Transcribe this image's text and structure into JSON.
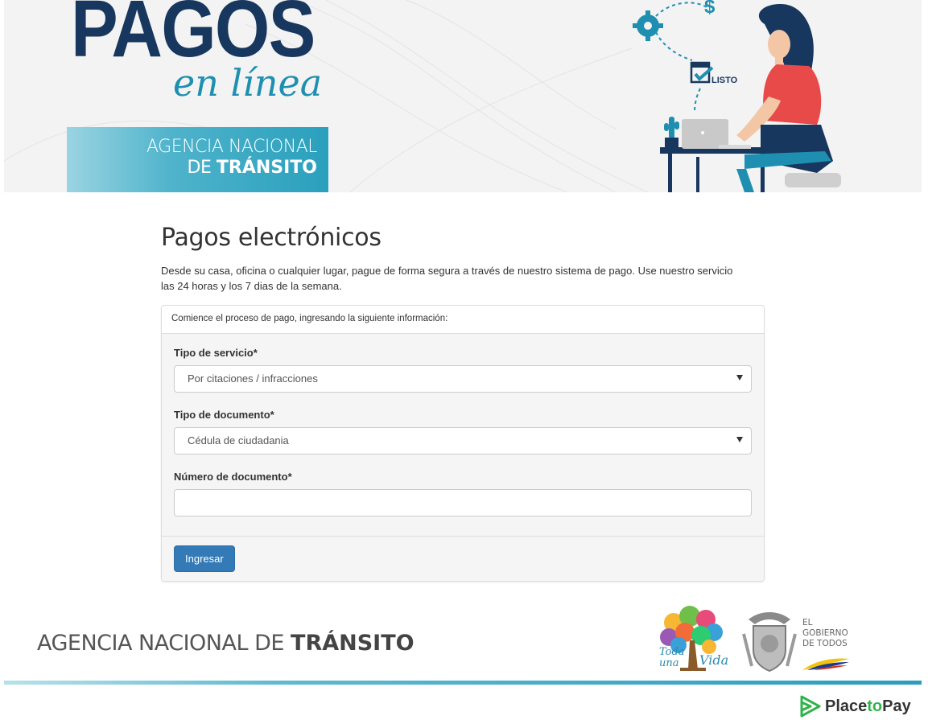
{
  "banner": {
    "title": "PAGOS",
    "subtitle": "en línea",
    "agency_line1": "AGENCIA NACIONAL",
    "agency_line2_prefix": "DE ",
    "agency_line2_bold": "TRÁNSITO",
    "listo_label": "LISTO",
    "illustration_icons": [
      "gear-icon",
      "dollar-icon",
      "calendar-check-icon",
      "laptop-icon",
      "cactus-icon",
      "woman-at-desk-illustration"
    ]
  },
  "main": {
    "title": "Pagos electrónicos",
    "intro": "Desde su casa, oficina o cualquier lugar, pague de forma segura a través de nuestro sistema de pago. Use nuestro servicio las 24 horas y los 7 dias de la semana."
  },
  "form": {
    "heading": "Comience el proceso de pago, ingresando la siguiente información:",
    "service_label": "Tipo de servicio*",
    "service_value": "Por citaciones / infracciones",
    "doctype_label": "Tipo de documento*",
    "doctype_value": "Cédula de ciudadania",
    "docnumber_label": "Número de documento*",
    "docnumber_value": "",
    "submit_label": "Ingresar"
  },
  "footer": {
    "agency_prefix": "AGENCIA NACIONAL DE ",
    "agency_bold": "TRÁNSITO",
    "tree_text": "Toda una Vida",
    "gobierno_line1": "EL",
    "gobierno_line2": "GOBIERNO",
    "gobierno_line3": "DE TODOS",
    "placetopay_prefix": "Place",
    "placetopay_to": "to",
    "placetopay_suffix": "Pay"
  },
  "colors": {
    "brand_navy": "#17375e",
    "brand_teal": "#2aa0bd",
    "primary_button": "#337ab7",
    "placetopay_green": "#2fb44a"
  }
}
